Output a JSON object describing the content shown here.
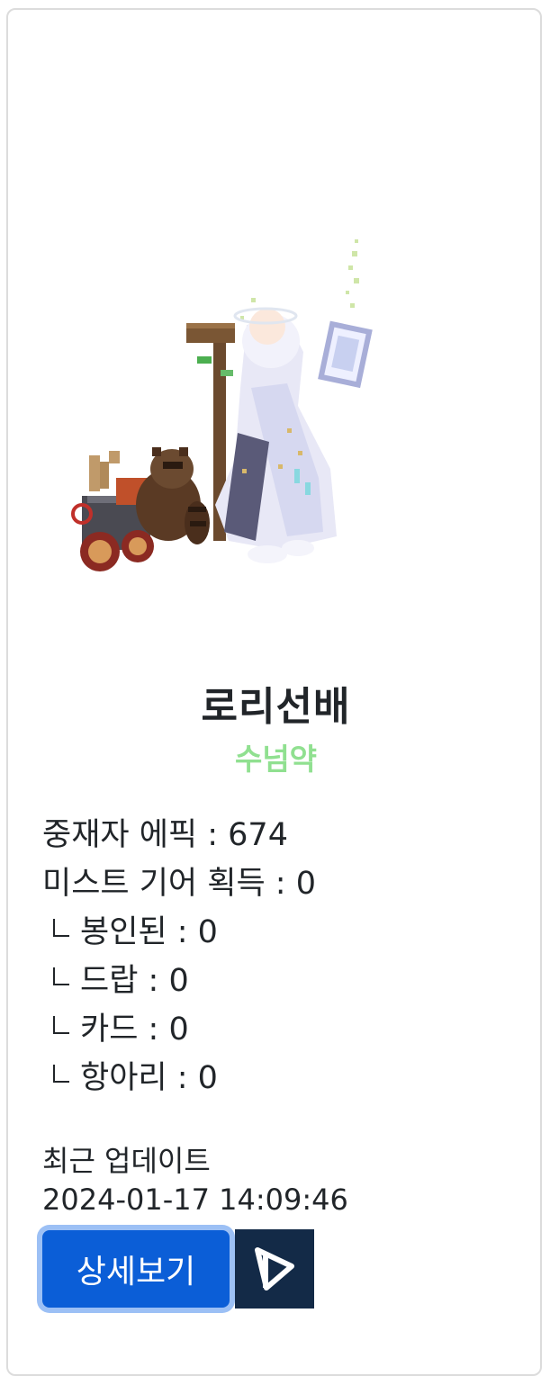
{
  "character": {
    "name": "로리선배",
    "guild": "수넘약",
    "guild_color": "#90e090"
  },
  "stats": {
    "epic": "중재자 에픽 : 674",
    "mist_gear": "미스트 기어 획득 : 0",
    "sub_items": [
      "봉인된 : 0",
      "드랍 : 0",
      "카드 : 0",
      "항아리 : 0"
    ]
  },
  "update": {
    "label": "최근 업데이트",
    "time": "2024-01-17 14:09:46"
  },
  "buttons": {
    "detail_label": "상세보기",
    "logo_icon": "dundam-logo-icon",
    "primary_color": "#0b5ed7",
    "logo_bg": "#132a47"
  }
}
